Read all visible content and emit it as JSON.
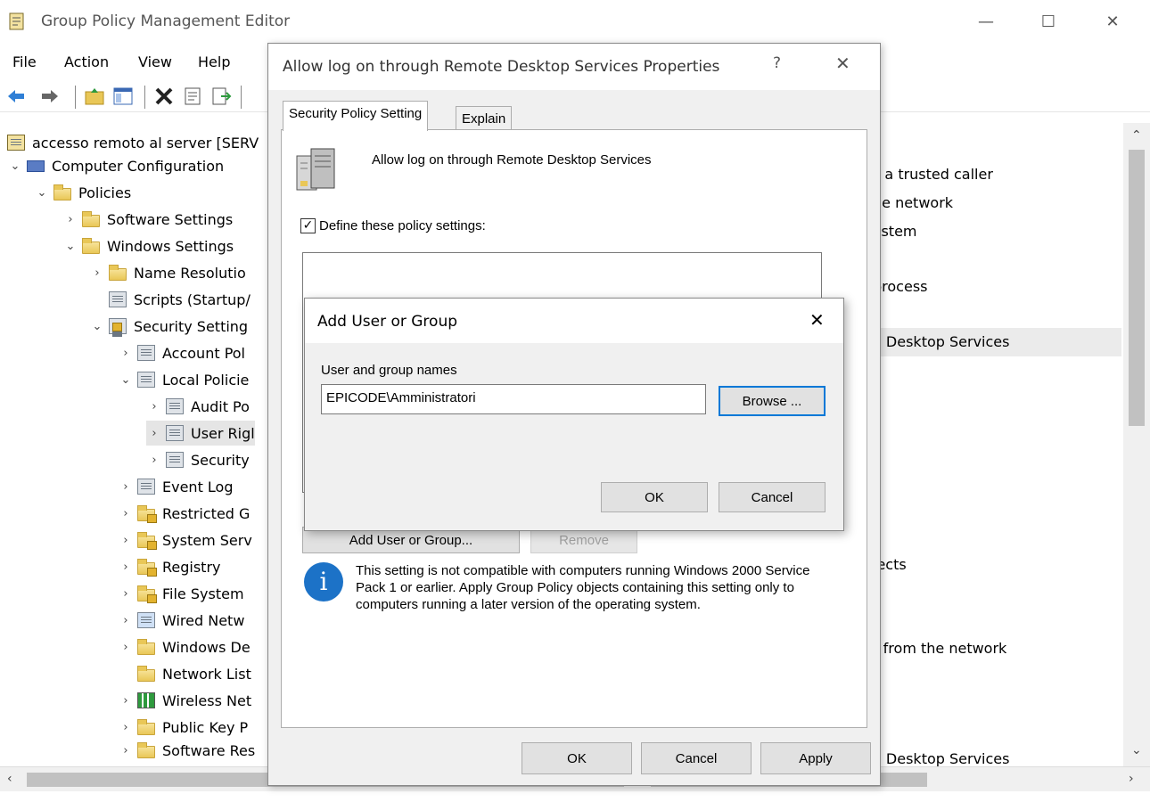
{
  "window": {
    "title": "Group Policy Management Editor",
    "controls": {
      "minimize": "—",
      "maximize": "☐",
      "close": "✕"
    }
  },
  "menu": [
    "File",
    "Action",
    "View",
    "Help"
  ],
  "tree": [
    {
      "label": "accesso remoto al server [SERV",
      "icon": "gpo-icon",
      "level": 0
    },
    {
      "label": "Computer Configuration",
      "icon": "computer-icon",
      "expanded": true
    },
    {
      "label": "Policies",
      "icon": "folder-icon",
      "expanded": true
    },
    {
      "label": "Software Settings",
      "icon": "folder-icon",
      "expanded": false
    },
    {
      "label": "Windows Settings",
      "icon": "folder-icon",
      "expanded": true
    },
    {
      "label": "Name Resolutio",
      "icon": "folder-icon",
      "expanded": false
    },
    {
      "label": "Scripts (Startup/",
      "icon": "script-icon"
    },
    {
      "label": "Security Setting",
      "icon": "security-icon",
      "expanded": true
    },
    {
      "label": "Account Pol",
      "icon": "policy-icon",
      "expanded": false
    },
    {
      "label": "Local Policie",
      "icon": "policy-icon",
      "expanded": true
    },
    {
      "label": "Audit Po",
      "icon": "policy-icon",
      "expanded": false
    },
    {
      "label": "User Rigl",
      "icon": "policy-icon",
      "expanded": false
    },
    {
      "label": "Security",
      "icon": "policy-icon",
      "expanded": false
    },
    {
      "label": "Event Log",
      "icon": "policy-icon",
      "expanded": false
    },
    {
      "label": "Restricted G",
      "icon": "locked-folder-icon",
      "expanded": false
    },
    {
      "label": "System Serv",
      "icon": "locked-folder-icon",
      "expanded": false
    },
    {
      "label": "Registry",
      "icon": "locked-folder-icon",
      "expanded": false
    },
    {
      "label": "File System",
      "icon": "locked-folder-icon",
      "expanded": false
    },
    {
      "label": "Wired Netw",
      "icon": "network-icon",
      "expanded": false
    },
    {
      "label": "Windows De",
      "icon": "folder-icon",
      "expanded": false
    },
    {
      "label": "Network List",
      "icon": "folder-icon"
    },
    {
      "label": "Wireless Net",
      "icon": "wireless-icon",
      "expanded": false
    },
    {
      "label": "Public Key P",
      "icon": "folder-icon",
      "expanded": false
    },
    {
      "label": "Software Res",
      "icon": "folder-icon",
      "expanded": false
    }
  ],
  "right_pane": {
    "rows": [
      "s a trusted caller",
      "he network",
      "ystem",
      "process",
      "e Desktop Services",
      "jects",
      "r from the network",
      "e Desktop Services"
    ]
  },
  "properties_dialog": {
    "title": "Allow log on through Remote Desktop Services Properties",
    "help": "?",
    "close": "✕",
    "tabs": [
      "Security Policy Setting",
      "Explain"
    ],
    "policy_name": "Allow log on through Remote Desktop Services",
    "checkbox_label": "Define these policy settings:",
    "checkbox_checked": "✓",
    "add_button": "Add User or Group...",
    "remove_button": "Remove",
    "info_text": "This setting is not compatible with computers running Windows 2000 Service Pack 1 or earlier.  Apply Group Policy objects containing this setting only to computers running a later version of the operating system.",
    "info_glyph": "i",
    "ok": "OK",
    "cancel": "Cancel",
    "apply": "Apply"
  },
  "add_dialog": {
    "title": "Add User or Group",
    "close": "✕",
    "label": "User and group names",
    "value": "EPICODE\\Amministratori",
    "browse": "Browse ...",
    "ok": "OK",
    "cancel": "Cancel"
  }
}
